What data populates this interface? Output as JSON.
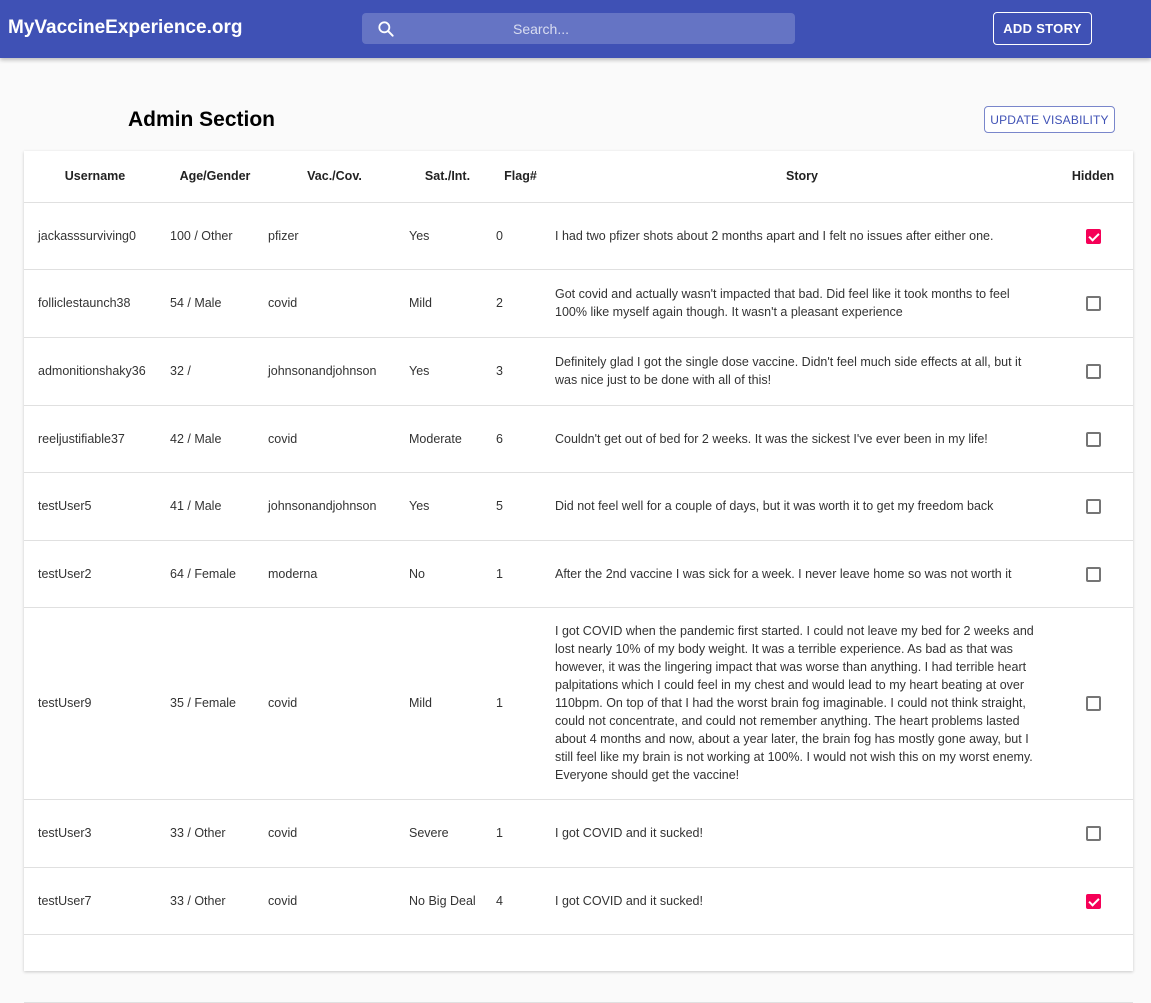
{
  "header": {
    "brand": "MyVaccineExperience.org",
    "search_placeholder": "Search...",
    "add_story_label": "ADD STORY",
    "icon": "search-icon"
  },
  "admin": {
    "title": "Admin Section",
    "update_label": "UPDATE VISABILITY"
  },
  "table": {
    "columns": [
      "Username",
      "Age/Gender",
      "Vac./Cov.",
      "Sat./Int.",
      "Flag#",
      "Story",
      "Hidden"
    ],
    "rows": [
      {
        "username": "jackasssurviving0",
        "age_gender": "100 / Other",
        "vac": "pfizer",
        "sat": "Yes",
        "flag": "0",
        "story": "I had two pfizer shots about 2 months apart and I felt no issues after either one.",
        "hidden": true
      },
      {
        "username": "folliclestaunch38",
        "age_gender": "54 / Male",
        "vac": "covid",
        "sat": "Mild",
        "flag": "2",
        "story": "Got covid and actually wasn't impacted that bad. Did feel like it took months to feel 100% like myself again though. It wasn't a pleasant experience",
        "hidden": false
      },
      {
        "username": "admonitionshaky36",
        "age_gender": "32 /",
        "vac": "johnsonandjohnson",
        "sat": "Yes",
        "flag": "3",
        "story": "Definitely glad I got the single dose vaccine. Didn't feel much side effects at all, but it was nice just to be done with all of this!",
        "hidden": false
      },
      {
        "username": "reeljustifiable37",
        "age_gender": "42 / Male",
        "vac": "covid",
        "sat": "Moderate",
        "flag": "6",
        "story": "Couldn't get out of bed for 2 weeks. It was the sickest I've ever been in my life!",
        "hidden": false
      },
      {
        "username": "testUser5",
        "age_gender": "41 / Male",
        "vac": "johnsonandjohnson",
        "sat": "Yes",
        "flag": "5",
        "story": "Did not feel well for a couple of days, but it was worth it to get my freedom back",
        "hidden": false
      },
      {
        "username": "testUser2",
        "age_gender": "64 / Female",
        "vac": "moderna",
        "sat": "No",
        "flag": "1",
        "story": "After the 2nd vaccine I was sick for a week. I never leave home so was not worth it",
        "hidden": false
      },
      {
        "username": "testUser9",
        "age_gender": "35 / Female",
        "vac": "covid",
        "sat": "Mild",
        "flag": "1",
        "story": "I got COVID when the pandemic first started. I could not leave my bed for 2 weeks and lost nearly 10% of my body weight. It was a terrible experience. As bad as that was however, it was the lingering impact that was worse than anything. I had terrible heart palpitations which I could feel in my chest and would lead to my heart beating at over 110bpm. On top of that I had the worst brain fog imaginable. I could not think straight, could not concentrate, and could not remember anything. The heart problems lasted about 4 months and now, about a year later, the brain fog has mostly gone away, but I still feel like my brain is not working at 100%. I would not wish this on my worst enemy. Everyone should get the vaccine!",
        "hidden": false
      },
      {
        "username": "testUser3",
        "age_gender": "33 / Other",
        "vac": "covid",
        "sat": "Severe",
        "flag": "1",
        "story": "I got COVID and it sucked!",
        "hidden": false
      },
      {
        "username": "testUser7",
        "age_gender": "33 / Other",
        "vac": "covid",
        "sat": "No Big Deal",
        "flag": "4",
        "story": "I got COVID and it sucked!",
        "hidden": true
      }
    ]
  }
}
